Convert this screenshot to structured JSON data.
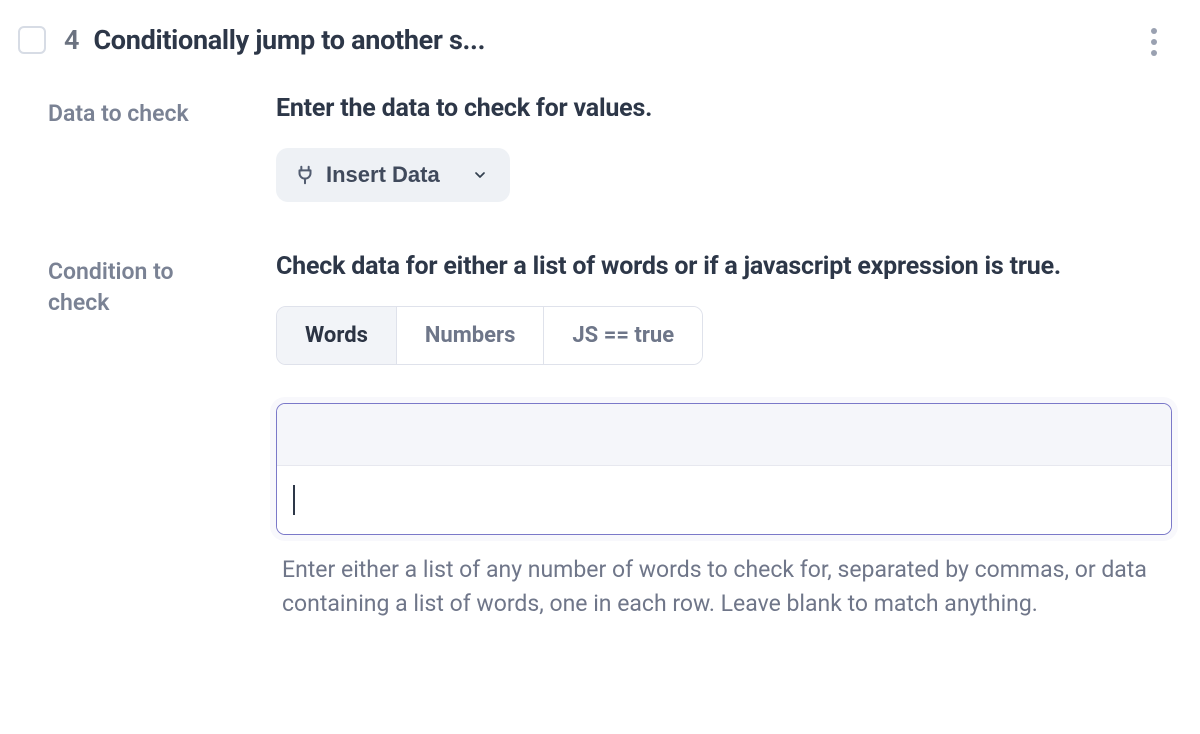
{
  "header": {
    "step_number": "4",
    "title": "Conditionally jump to another s..."
  },
  "data_to_check": {
    "label": "Data to check",
    "description": "Enter the data to check for values.",
    "insert_button": "Insert Data"
  },
  "condition": {
    "label": "Condition to check",
    "description": "Check data for either a list of words or if a javascript expression is true.",
    "tabs": {
      "words": "Words",
      "numbers": "Numbers",
      "js": "JS == true"
    },
    "help": "Enter either a list of any number of words to check for, separated by commas, or data containing a list of words, one in each row. Leave blank to match anything."
  }
}
